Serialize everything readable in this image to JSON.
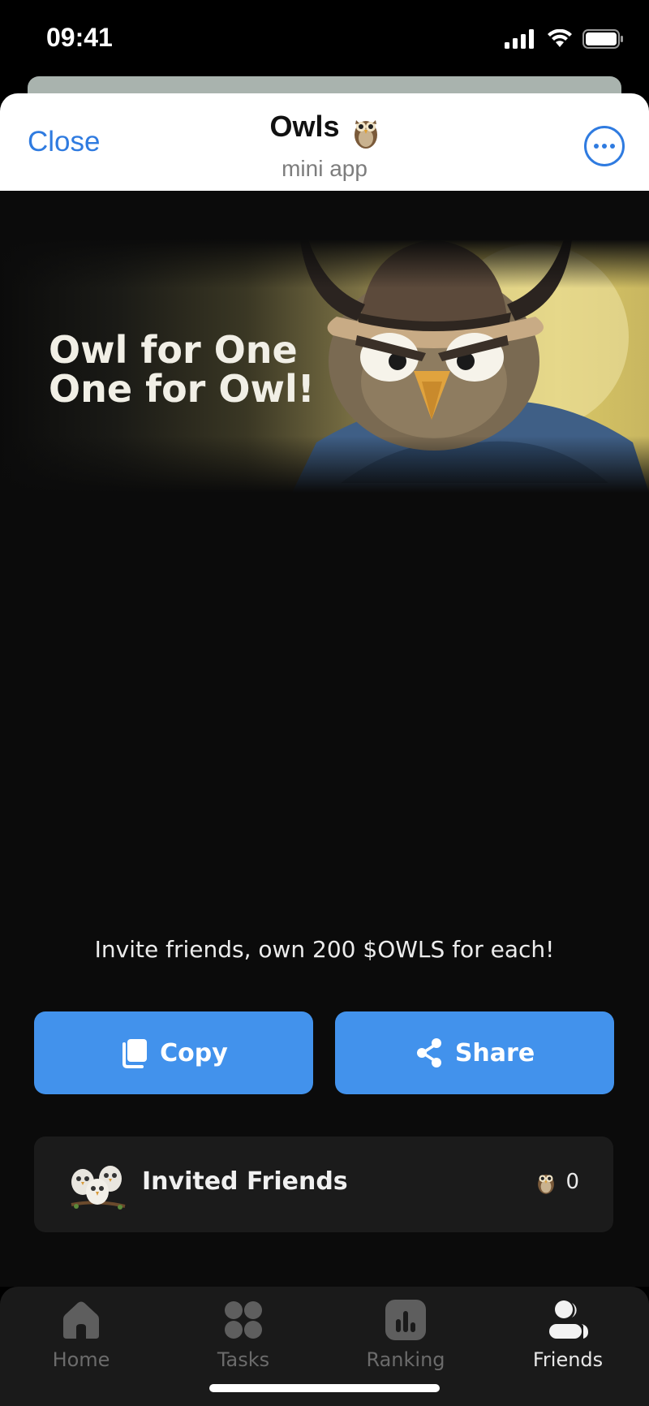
{
  "status": {
    "time": "09:41"
  },
  "header": {
    "close_label": "Close",
    "title": "Owls",
    "subtitle": "mini app"
  },
  "banner": {
    "line1": "Owl for One",
    "line2": "One for Owl!"
  },
  "invite": {
    "text": "Invite friends, own 200 $OWLS for each!",
    "copy_label": "Copy",
    "share_label": "Share"
  },
  "invited_card": {
    "label": "Invited Friends",
    "count": "0"
  },
  "nav": {
    "items": [
      {
        "label": "Home",
        "icon": "home-icon"
      },
      {
        "label": "Tasks",
        "icon": "tasks-icon"
      },
      {
        "label": "Ranking",
        "icon": "ranking-icon"
      },
      {
        "label": "Friends",
        "icon": "friends-icon",
        "active": true
      }
    ]
  },
  "colors": {
    "accent": "#4292ec",
    "link": "#2f7be0",
    "background": "#0b0b0b"
  }
}
